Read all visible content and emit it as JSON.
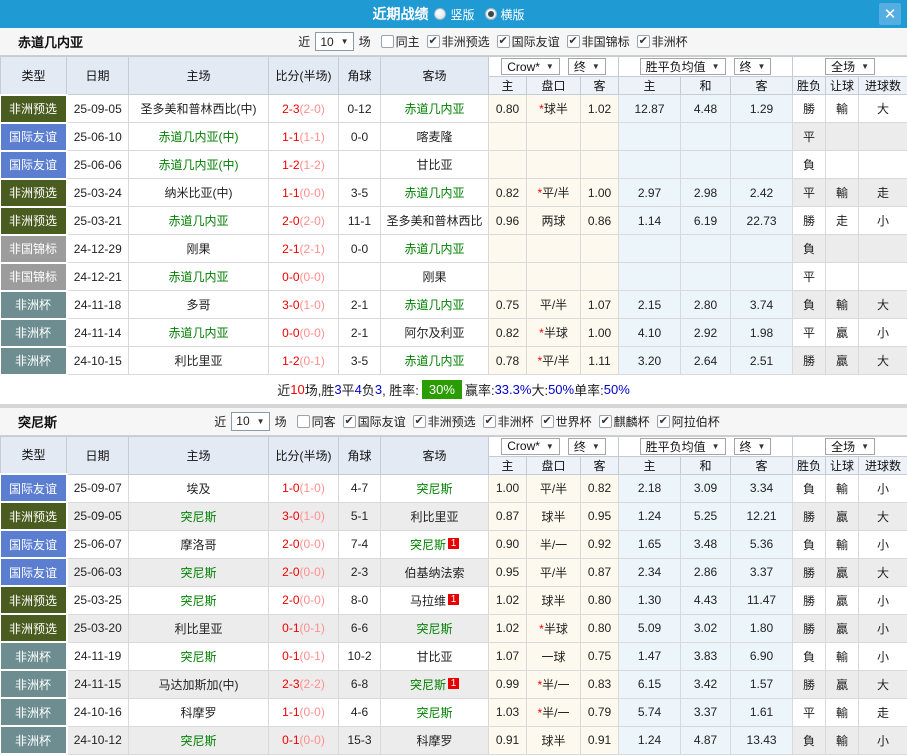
{
  "titlebar": {
    "title": "近期战绩",
    "radios": [
      {
        "label": "竖版",
        "selected": false
      },
      {
        "label": "横版",
        "selected": true
      }
    ],
    "close_glyph": "✕"
  },
  "colors": {
    "type_badges": {
      "非洲预选": "#4a5c1f",
      "国际友谊": "#5b7ed0",
      "非国锦标": "#9c9c9c",
      "非洲杯": "#6d8d90"
    },
    "result": {
      "r": "#d10000",
      "g": "#007a00",
      "b": "#0000cc"
    },
    "win_rate_badge": "#2a9e00",
    "titlebar_blue": "#1f9ad3"
  },
  "table_header": {
    "left": [
      "类型",
      "日期",
      "主场",
      "比分(半场)",
      "角球",
      "客场"
    ],
    "dropdown_groups": [
      [
        "Crow*",
        "终"
      ],
      [
        "胜平负均值",
        "终"
      ],
      [
        "全场"
      ]
    ],
    "sub": [
      "主",
      "盘口",
      "客",
      "主",
      "和",
      "客",
      "胜负",
      "让球",
      "进球数"
    ]
  },
  "tables": [
    {
      "team": "赤道几内亚",
      "filter": {
        "prefix": "近",
        "count": "10",
        "suffix": "场",
        "venue": {
          "label": "同主",
          "checked": false
        },
        "competitions": [
          {
            "label": "非洲预选",
            "checked": true
          },
          {
            "label": "国际友谊",
            "checked": true
          },
          {
            "label": "非国锦标",
            "checked": true
          },
          {
            "label": "非洲杯",
            "checked": true
          }
        ]
      },
      "rows": [
        {
          "type": "非洲预选",
          "date": "25-09-05",
          "home": "圣多美和普林西比(中)",
          "score": "2-3",
          "half": "(2-0)",
          "corner": "0-12",
          "away": "赤道几内亚",
          "awayFocus": true,
          "odds": [
            "0.80",
            "*球半",
            "1.02"
          ],
          "avg": [
            "12.87",
            "4.48",
            "1.29"
          ],
          "res": [
            [
              "勝",
              "r"
            ],
            [
              "輸",
              "g"
            ],
            [
              "大",
              "r"
            ]
          ]
        },
        {
          "type": "国际友谊",
          "date": "25-06-10",
          "home": "赤道几内亚(中)",
          "homeFocus": true,
          "score": "1-1",
          "half": "(1-1)",
          "corner": "0-0",
          "away": "喀麦隆",
          "odds": [
            "",
            "",
            ""
          ],
          "avg": [
            "",
            "",
            ""
          ],
          "res": [
            [
              "平",
              "b"
            ],
            [
              "",
              ""
            ],
            [
              "",
              ""
            ]
          ]
        },
        {
          "type": "国际友谊",
          "date": "25-06-06",
          "home": "赤道几内亚(中)",
          "homeFocus": true,
          "score": "1-2",
          "half": "(1-2)",
          "corner": "",
          "away": "甘比亚",
          "odds": [
            "",
            "",
            ""
          ],
          "avg": [
            "",
            "",
            ""
          ],
          "res": [
            [
              "負",
              "g"
            ],
            [
              "",
              ""
            ],
            [
              "",
              ""
            ]
          ]
        },
        {
          "type": "非洲预选",
          "date": "25-03-24",
          "home": "纳米比亚(中)",
          "score": "1-1",
          "half": "(0-0)",
          "corner": "3-5",
          "away": "赤道几内亚",
          "awayFocus": true,
          "odds": [
            "0.82",
            "*平/半",
            "1.00"
          ],
          "avg": [
            "2.97",
            "2.98",
            "2.42"
          ],
          "res": [
            [
              "平",
              "b"
            ],
            [
              "輸",
              "g"
            ],
            [
              "走",
              "b"
            ]
          ]
        },
        {
          "type": "非洲预选",
          "date": "25-03-21",
          "home": "赤道几内亚",
          "homeFocus": true,
          "score": "2-0",
          "half": "(2-0)",
          "corner": "11-1",
          "away": "圣多美和普林西比",
          "odds": [
            "0.96",
            "两球",
            "0.86"
          ],
          "avg": [
            "1.14",
            "6.19",
            "22.73"
          ],
          "res": [
            [
              "勝",
              "r"
            ],
            [
              "走",
              "b"
            ],
            [
              "小",
              "g"
            ]
          ]
        },
        {
          "type": "非国锦标",
          "date": "24-12-29",
          "home": "刚果",
          "score": "2-1",
          "half": "(2-1)",
          "corner": "0-0",
          "away": "赤道几内亚",
          "awayFocus": true,
          "odds": [
            "",
            "",
            ""
          ],
          "avg": [
            "",
            "",
            ""
          ],
          "res": [
            [
              "負",
              "g"
            ],
            [
              "",
              ""
            ],
            [
              "",
              ""
            ]
          ]
        },
        {
          "type": "非国锦标",
          "date": "24-12-21",
          "home": "赤道几内亚",
          "homeFocus": true,
          "score": "0-0",
          "half": "(0-0)",
          "corner": "",
          "away": "刚果",
          "odds": [
            "",
            "",
            ""
          ],
          "avg": [
            "",
            "",
            ""
          ],
          "res": [
            [
              "平",
              "b"
            ],
            [
              "",
              ""
            ],
            [
              "",
              ""
            ]
          ]
        },
        {
          "type": "非洲杯",
          "date": "24-11-18",
          "home": "多哥",
          "score": "3-0",
          "half": "(1-0)",
          "corner": "2-1",
          "away": "赤道几内亚",
          "awayFocus": true,
          "odds": [
            "0.75",
            "平/半",
            "1.07"
          ],
          "avg": [
            "2.15",
            "2.80",
            "3.74"
          ],
          "res": [
            [
              "負",
              "g"
            ],
            [
              "輸",
              "g"
            ],
            [
              "大",
              "r"
            ]
          ]
        },
        {
          "type": "非洲杯",
          "date": "24-11-14",
          "home": "赤道几内亚",
          "homeFocus": true,
          "score": "0-0",
          "half": "(0-0)",
          "corner": "2-1",
          "away": "阿尔及利亚",
          "odds": [
            "0.82",
            "*半球",
            "1.00"
          ],
          "avg": [
            "4.10",
            "2.92",
            "1.98"
          ],
          "res": [
            [
              "平",
              "b"
            ],
            [
              "贏",
              "r"
            ],
            [
              "小",
              "g"
            ]
          ]
        },
        {
          "type": "非洲杯",
          "date": "24-10-15",
          "home": "利比里亚",
          "score": "1-2",
          "half": "(0-1)",
          "corner": "3-5",
          "away": "赤道几内亚",
          "awayFocus": true,
          "odds": [
            "0.78",
            "*平/半",
            "1.11"
          ],
          "avg": [
            "3.20",
            "2.64",
            "2.51"
          ],
          "res": [
            [
              "勝",
              "r"
            ],
            [
              "贏",
              "r"
            ],
            [
              "大",
              "r"
            ]
          ]
        }
      ],
      "summary": [
        {
          "t": "近",
          "c": "k"
        },
        {
          "t": "10",
          "c": "r"
        },
        {
          "t": "场,胜",
          "c": "k"
        },
        {
          "t": "3",
          "c": "b"
        },
        {
          "t": "平",
          "c": "k"
        },
        {
          "t": "4",
          "c": "b"
        },
        {
          "t": "负",
          "c": "k"
        },
        {
          "t": "3",
          "c": "b"
        },
        {
          "t": ", 胜率: ",
          "c": "k"
        },
        {
          "t": "30%",
          "c": "badge"
        },
        {
          "t": " 赢率:",
          "c": "k"
        },
        {
          "t": "33.3%",
          "c": "b"
        },
        {
          "t": " 大:",
          "c": "k"
        },
        {
          "t": "50%",
          "c": "b"
        },
        {
          "t": " 单率:",
          "c": "k"
        },
        {
          "t": "50%",
          "c": "b"
        }
      ]
    },
    {
      "team": "突尼斯",
      "filter": {
        "prefix": "近",
        "count": "10",
        "suffix": "场",
        "venue": {
          "label": "同客",
          "checked": false
        },
        "competitions": [
          {
            "label": "国际友谊",
            "checked": true
          },
          {
            "label": "非洲预选",
            "checked": true
          },
          {
            "label": "非洲杯",
            "checked": true
          },
          {
            "label": "世界杯",
            "checked": true
          },
          {
            "label": "麒麟杯",
            "checked": true
          },
          {
            "label": "阿拉伯杯",
            "checked": true
          }
        ]
      },
      "rows": [
        {
          "type": "国际友谊",
          "date": "25-09-07",
          "home": "埃及",
          "score": "1-0",
          "half": "(1-0)",
          "corner": "4-7",
          "away": "突尼斯",
          "awayFocus": true,
          "odds": [
            "1.00",
            "平/半",
            "0.82"
          ],
          "avg": [
            "2.18",
            "3.09",
            "3.34"
          ],
          "res": [
            [
              "負",
              "g"
            ],
            [
              "輸",
              "g"
            ],
            [
              "小",
              "g"
            ]
          ]
        },
        {
          "type": "非洲预选",
          "date": "25-09-05",
          "home": "突尼斯",
          "homeFocus": true,
          "score": "3-0",
          "half": "(1-0)",
          "corner": "5-1",
          "away": "利比里亚",
          "odds": [
            "0.87",
            "球半",
            "0.95"
          ],
          "avg": [
            "1.24",
            "5.25",
            "12.21"
          ],
          "res": [
            [
              "勝",
              "r"
            ],
            [
              "贏",
              "r"
            ],
            [
              "大",
              "r"
            ]
          ]
        },
        {
          "type": "国际友谊",
          "date": "25-06-07",
          "home": "摩洛哥",
          "score": "2-0",
          "half": "(0-0)",
          "corner": "7-4",
          "away": "突尼斯",
          "awayFocus": true,
          "awayRc": 1,
          "odds": [
            "0.90",
            "半/一",
            "0.92"
          ],
          "avg": [
            "1.65",
            "3.48",
            "5.36"
          ],
          "res": [
            [
              "負",
              "g"
            ],
            [
              "輸",
              "g"
            ],
            [
              "小",
              "g"
            ]
          ]
        },
        {
          "type": "国际友谊",
          "date": "25-06-03",
          "home": "突尼斯",
          "homeFocus": true,
          "score": "2-0",
          "half": "(0-0)",
          "corner": "2-3",
          "away": "伯基纳法索",
          "odds": [
            "0.95",
            "平/半",
            "0.87"
          ],
          "avg": [
            "2.34",
            "2.86",
            "3.37"
          ],
          "res": [
            [
              "勝",
              "r"
            ],
            [
              "贏",
              "r"
            ],
            [
              "大",
              "r"
            ]
          ]
        },
        {
          "type": "非洲预选",
          "date": "25-03-25",
          "home": "突尼斯",
          "homeFocus": true,
          "score": "2-0",
          "half": "(0-0)",
          "corner": "8-0",
          "away": "马拉维",
          "awayRc": 1,
          "odds": [
            "1.02",
            "球半",
            "0.80"
          ],
          "avg": [
            "1.30",
            "4.43",
            "11.47"
          ],
          "res": [
            [
              "勝",
              "r"
            ],
            [
              "贏",
              "r"
            ],
            [
              "小",
              "g"
            ]
          ]
        },
        {
          "type": "非洲预选",
          "date": "25-03-20",
          "home": "利比里亚",
          "score": "0-1",
          "half": "(0-1)",
          "corner": "6-6",
          "away": "突尼斯",
          "awayFocus": true,
          "odds": [
            "1.02",
            "*半球",
            "0.80"
          ],
          "avg": [
            "5.09",
            "3.02",
            "1.80"
          ],
          "res": [
            [
              "勝",
              "r"
            ],
            [
              "贏",
              "r"
            ],
            [
              "小",
              "g"
            ]
          ]
        },
        {
          "type": "非洲杯",
          "date": "24-11-19",
          "home": "突尼斯",
          "homeFocus": true,
          "score": "0-1",
          "half": "(0-1)",
          "corner": "10-2",
          "away": "甘比亚",
          "odds": [
            "1.07",
            "一球",
            "0.75"
          ],
          "avg": [
            "1.47",
            "3.83",
            "6.90"
          ],
          "res": [
            [
              "負",
              "g"
            ],
            [
              "輸",
              "g"
            ],
            [
              "小",
              "g"
            ]
          ]
        },
        {
          "type": "非洲杯",
          "date": "24-11-15",
          "home": "马达加斯加(中)",
          "score": "2-3",
          "half": "(2-2)",
          "corner": "6-8",
          "away": "突尼斯",
          "awayFocus": true,
          "awayRc": 1,
          "odds": [
            "0.99",
            "*半/一",
            "0.83"
          ],
          "avg": [
            "6.15",
            "3.42",
            "1.57"
          ],
          "res": [
            [
              "勝",
              "r"
            ],
            [
              "贏",
              "r"
            ],
            [
              "大",
              "r"
            ]
          ]
        },
        {
          "type": "非洲杯",
          "date": "24-10-16",
          "home": "科摩罗",
          "score": "1-1",
          "half": "(0-0)",
          "corner": "4-6",
          "away": "突尼斯",
          "awayFocus": true,
          "odds": [
            "1.03",
            "*半/一",
            "0.79"
          ],
          "avg": [
            "5.74",
            "3.37",
            "1.61"
          ],
          "res": [
            [
              "平",
              "b"
            ],
            [
              "輸",
              "g"
            ],
            [
              "走",
              "b"
            ]
          ]
        },
        {
          "type": "非洲杯",
          "date": "24-10-12",
          "home": "突尼斯",
          "homeFocus": true,
          "score": "0-1",
          "half": "(0-0)",
          "corner": "15-3",
          "away": "科摩罗",
          "odds": [
            "0.91",
            "球半",
            "0.91"
          ],
          "avg": [
            "1.24",
            "4.87",
            "13.43"
          ],
          "res": [
            [
              "負",
              "g"
            ],
            [
              "輸",
              "g"
            ],
            [
              "小",
              "g"
            ]
          ]
        }
      ],
      "summary": null
    }
  ]
}
